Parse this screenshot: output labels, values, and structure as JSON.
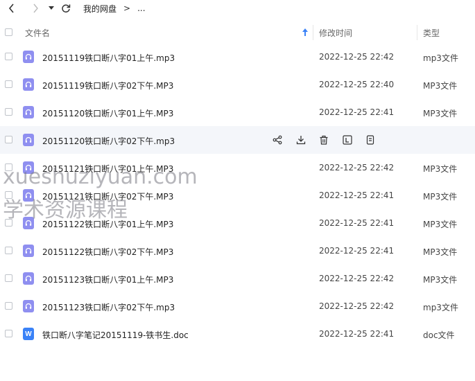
{
  "nav": {
    "back_icon": "chevron-left-icon",
    "forward_icon": "chevron-right-icon",
    "dropdown_icon": "caret-down-icon",
    "refresh_icon": "refresh-icon"
  },
  "breadcrumb": {
    "root": "我的网盘",
    "separator": ">",
    "current": "..."
  },
  "columns": {
    "name": "文件名",
    "modified": "修改时间",
    "type": "类型"
  },
  "files": [
    {
      "name": "20151119铁口断八字01上午.mp3",
      "modified": "2022-12-25 22:42",
      "type": "mp3文件",
      "icon": "audio"
    },
    {
      "name": "20151119铁口断八字02下午.MP3",
      "modified": "2022-12-25 22:40",
      "type": "MP3文件",
      "icon": "audio"
    },
    {
      "name": "20151120铁口断八字01上午.MP3",
      "modified": "2022-12-25 22:41",
      "type": "MP3文件",
      "icon": "audio"
    },
    {
      "name": "20151120铁口断八字02下午.mp3",
      "modified": "",
      "type": "",
      "icon": "audio",
      "hover": true
    },
    {
      "name": "20151121铁口断八字01上午.MP3",
      "modified": "2022-12-25 22:42",
      "type": "MP3文件",
      "icon": "audio"
    },
    {
      "name": "20151121铁口断八字02下午.MP3",
      "modified": "2022-12-25 22:41",
      "type": "MP3文件",
      "icon": "audio"
    },
    {
      "name": "20151122铁口断八字01上午.MP3",
      "modified": "2022-12-25 22:41",
      "type": "MP3文件",
      "icon": "audio"
    },
    {
      "name": "20151122铁口断八字02下午.MP3",
      "modified": "2022-12-25 22:41",
      "type": "MP3文件",
      "icon": "audio"
    },
    {
      "name": "20151123铁口断八字01上午.MP3",
      "modified": "2022-12-25 22:42",
      "type": "MP3文件",
      "icon": "audio"
    },
    {
      "name": "20151123铁口断八字02下午.mp3",
      "modified": "2022-12-25 22:42",
      "type": "mp3文件",
      "icon": "audio"
    },
    {
      "name": "铁口断八字笔记20151119-铁书生.doc",
      "modified": "2022-12-25 22:41",
      "type": "doc文件",
      "icon": "doc"
    }
  ],
  "hover_actions": [
    "share-icon",
    "download-icon",
    "delete-icon",
    "rename-icon",
    "more-icon"
  ],
  "doc_icon_letter": "W",
  "watermark": {
    "line1": "xueshuziyuan.com",
    "line2": "学术资源课程"
  },
  "colors": {
    "audio_icon": "#8f8ff0",
    "doc_icon": "#3a82f7",
    "sort_arrow": "#3a82f7",
    "hover_row": "#f4f6fa"
  }
}
